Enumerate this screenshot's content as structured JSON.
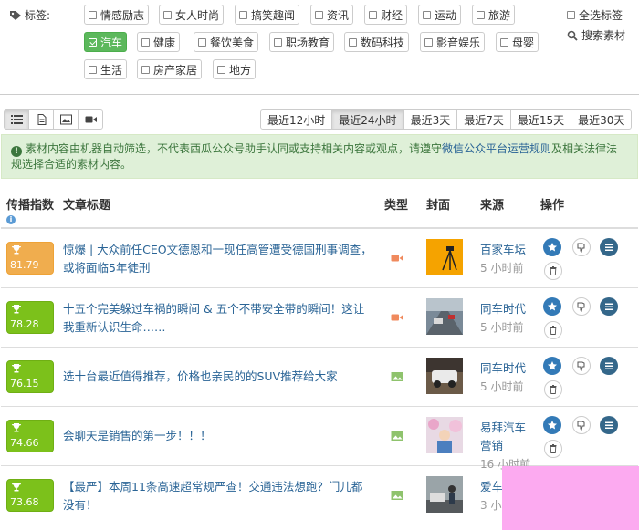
{
  "tags": {
    "label": "标签:",
    "row1": [
      "情感励志",
      "女人时尚",
      "搞笑趣闻",
      "资讯",
      "财经",
      "运动",
      "旅游"
    ],
    "row2": [
      {
        "label": "汽车",
        "checked": true
      },
      {
        "label": "健康",
        "checked": false
      },
      {
        "label": "餐饮美食",
        "checked": false
      },
      {
        "label": "职场教育",
        "checked": false
      },
      {
        "label": "数码科技",
        "checked": false
      },
      {
        "label": "影音娱乐",
        "checked": false
      },
      {
        "label": "母婴",
        "checked": false
      }
    ],
    "row3": [
      "生活",
      "房产家居",
      "地方"
    ],
    "select_all": "全选标签",
    "search": "搜索素材"
  },
  "view_modes": [
    "list-icon",
    "document-icon",
    "image-icon",
    "video-icon"
  ],
  "time_filters": {
    "items": [
      "最近12小时",
      "最近24小时",
      "最近3天",
      "最近7天",
      "最近15天",
      "最近30天"
    ],
    "active": "最近24小时"
  },
  "notice": {
    "text_before": "素材内容由机器自动筛选，不代表西瓜公众号助手认同或支持相关内容或观点，请遵守",
    "link": "微信公众平台运营规则",
    "text_after": "及相关法律法规选择合适的素材内容。"
  },
  "table": {
    "headers": {
      "index": "传播指数",
      "title": "文章标题",
      "type": "类型",
      "cover": "封面",
      "source": "来源",
      "actions": "操作"
    },
    "rows": [
      {
        "score": "81.79",
        "badge": "orange",
        "title": "惊爆 | 大众前任CEO文德恩和一现任高管遭受德国刑事调查，或将面临5年徒刑",
        "type": "video",
        "source": "百家车坛",
        "time": "5 小时前"
      },
      {
        "score": "78.28",
        "badge": "green",
        "title": "十五个完美躲过车祸的瞬间 & 五个不带安全带的瞬间！这让我重新认识生命……",
        "type": "video",
        "source": "同车时代",
        "time": "5 小时前"
      },
      {
        "score": "76.15",
        "badge": "green",
        "title": "选十台最近值得推荐，价格也亲民的的SUV推荐给大家",
        "type": "image",
        "source": "同车时代",
        "time": "5 小时前"
      },
      {
        "score": "74.66",
        "badge": "green",
        "title": "会聊天是销售的第一步！！！",
        "type": "image",
        "source": "易拜汽车营销",
        "time": "16 小时前"
      },
      {
        "score": "73.68",
        "badge": "green",
        "title": "【最严】本周11条高速超常规严查！交通违法想跑？门儿都没有！",
        "type": "image",
        "source": "爱车半",
        "time": "3 小时前"
      }
    ]
  },
  "colors": {
    "link": "#2a6496",
    "badge_orange": "#f0ad4e",
    "badge_green": "#7cc11b",
    "notice_bg": "#dff0d8",
    "checked_tag": "#5cb85c",
    "overlay": "#fcaaf0"
  }
}
